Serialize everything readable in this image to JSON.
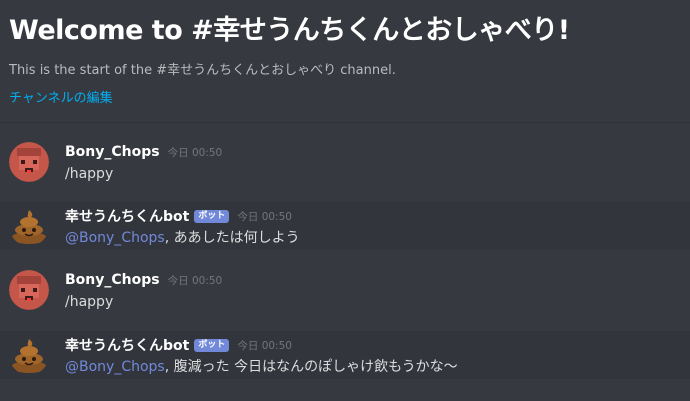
{
  "channel": {
    "welcome_title": "Welcome to #幸せうんちくんとおしゃべり!",
    "welcome_subtitle": "This is the start of the #幸せうんちくんとおしゃべり channel.",
    "edit_link": "チャンネルの編集"
  },
  "messages": [
    {
      "username": "Bony_Chops",
      "timestamp": "今日 00:50",
      "content": "/happy",
      "avatar": "pixel-face-avatar",
      "is_bot": false
    },
    {
      "username": "幸せうんちくんbot",
      "bot_tag": "ボット",
      "timestamp": "今日 00:50",
      "mention": "@Bony_Chops",
      "content": ", ああしたは何しよう",
      "avatar": "poop-avatar",
      "is_bot": true
    },
    {
      "username": "Bony_Chops",
      "timestamp": "今日 00:50",
      "content": "/happy",
      "avatar": "pixel-face-avatar",
      "is_bot": false
    },
    {
      "username": "幸せうんちくんbot",
      "bot_tag": "ボット",
      "timestamp": "今日 00:50",
      "mention": "@Bony_Chops",
      "content": ", 腹減った 今日はなんのぽしゃけ飲もうかな〜",
      "avatar": "poop-avatar",
      "is_bot": true
    }
  ],
  "colors": {
    "background": "#36393f",
    "bot_row_background": "#32353b",
    "link": "#00b0f4",
    "mention": "#7289da",
    "bot_tag": "#7289da"
  }
}
